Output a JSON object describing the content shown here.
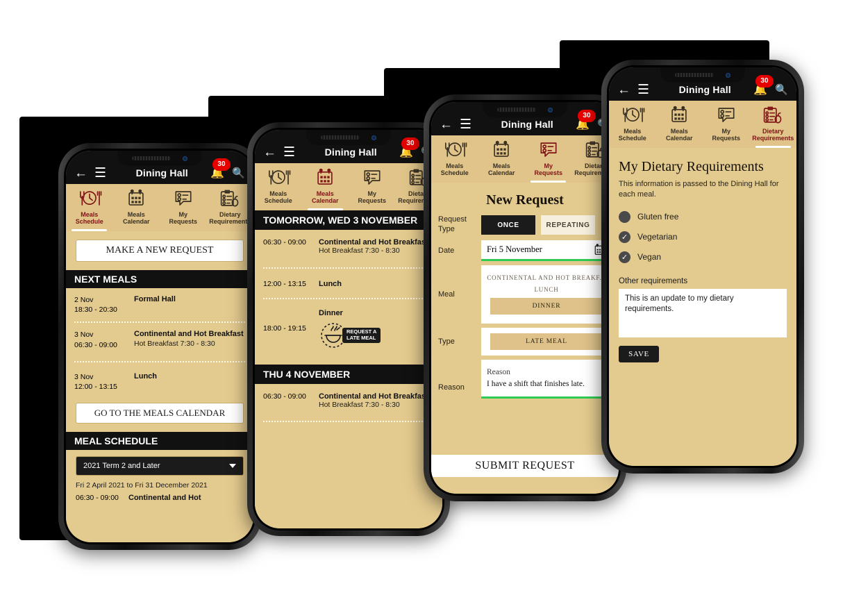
{
  "app": {
    "title": "Dining Hall",
    "badge_count": "30",
    "colors": {
      "tan": "#e3ca8f",
      "tab_tan": "#e0c489",
      "dark": "#111111",
      "accent_red": "#7e1416",
      "badge_red": "#e60000",
      "green_underline": "#2ecc55"
    }
  },
  "tabs": [
    {
      "label_line1": "Meals",
      "label_line2": "Schedule",
      "icon": "clock-cutlery-icon"
    },
    {
      "label_line1": "Meals",
      "label_line2": "Calendar",
      "icon": "calendar-icon"
    },
    {
      "label_line1": "My",
      "label_line2": "Requests",
      "icon": "speech-checklist-icon"
    },
    {
      "label_line1": "Dietary",
      "label_line2": "Requirements",
      "icon": "clipboard-apple-icon"
    }
  ],
  "phone1": {
    "active_tab": 0,
    "new_request_button": "MAKE A NEW REQUEST",
    "next_meals_header": "NEXT MEALS",
    "next_meals": [
      {
        "date": "2 Nov",
        "time": "18:30 - 20:30",
        "name": "Formal Hall",
        "sub": ""
      },
      {
        "date": "3 Nov",
        "time": "06:30 - 09:00",
        "name": "Continental and Hot Breakfast",
        "sub": "Hot Breakfast 7:30 - 8:30"
      },
      {
        "date": "3 Nov",
        "time": "12:00 - 13:15",
        "name": "Lunch",
        "sub": ""
      }
    ],
    "calendar_button": "GO TO THE MEALS CALENDAR",
    "meal_schedule_header": "MEAL SCHEDULE",
    "schedule_select_value": "2021 Term 2 and Later",
    "schedule_range": "Fri 2 April 2021 to Fri 31 December 2021",
    "schedule_rows": [
      {
        "time": "06:30 - 09:00",
        "name": "Continental and Hot"
      }
    ]
  },
  "phone2": {
    "active_tab": 1,
    "day_header_1": "TOMORROW, WED 3 NOVEMBER",
    "day1_meals": [
      {
        "time": "06:30 - 09:00",
        "name": "Continental and Hot Breakfast",
        "sub": "Hot Breakfast 7:30 - 8:30"
      },
      {
        "time": "12:00 - 13:15",
        "name": "Lunch",
        "sub": ""
      },
      {
        "time": "18:00 - 19:15",
        "name": "Dinner",
        "sub": "",
        "action_line1": "REQUEST A",
        "action_line2": "LATE MEAL"
      }
    ],
    "day_header_2": "THU 4 NOVEMBER",
    "day2_meals": [
      {
        "time": "06:30 - 09:00",
        "name": "Continental and Hot Breakfast",
        "sub": "Hot Breakfast 7:30 - 8:30"
      }
    ]
  },
  "phone3": {
    "active_tab": 2,
    "heading": "New Request",
    "fields": {
      "request_type_label_1": "Request",
      "request_type_label_2": "Type",
      "seg_once": "ONCE",
      "seg_repeating": "REPEATING",
      "date_label": "Date",
      "date_value": "Fri 5 November",
      "date_icon": "calendar-icon",
      "meal_label": "Meal",
      "meal_options": [
        "CONTINENTAL AND HOT BREAKF...",
        "LUNCH",
        "DINNER"
      ],
      "meal_selected": "DINNER",
      "type_label": "Type",
      "type_options": [
        "LATE MEAL"
      ],
      "type_selected": "LATE MEAL",
      "reason_label": "Reason",
      "reason_placeholder": "Reason",
      "reason_value": "I have a shift that finishes late."
    },
    "submit_button": "SUBMIT REQUEST"
  },
  "phone4": {
    "active_tab": 3,
    "heading": "My Dietary Requirements",
    "subtitle": "This information is passed to the Dining Hall for each meal.",
    "checkboxes": [
      {
        "label": "Gluten free",
        "checked": false
      },
      {
        "label": "Vegetarian",
        "checked": true
      },
      {
        "label": "Vegan",
        "checked": true
      }
    ],
    "other_label": "Other requirements",
    "other_value": "This is an update to my dietary requirements.",
    "save_button": "SAVE"
  }
}
